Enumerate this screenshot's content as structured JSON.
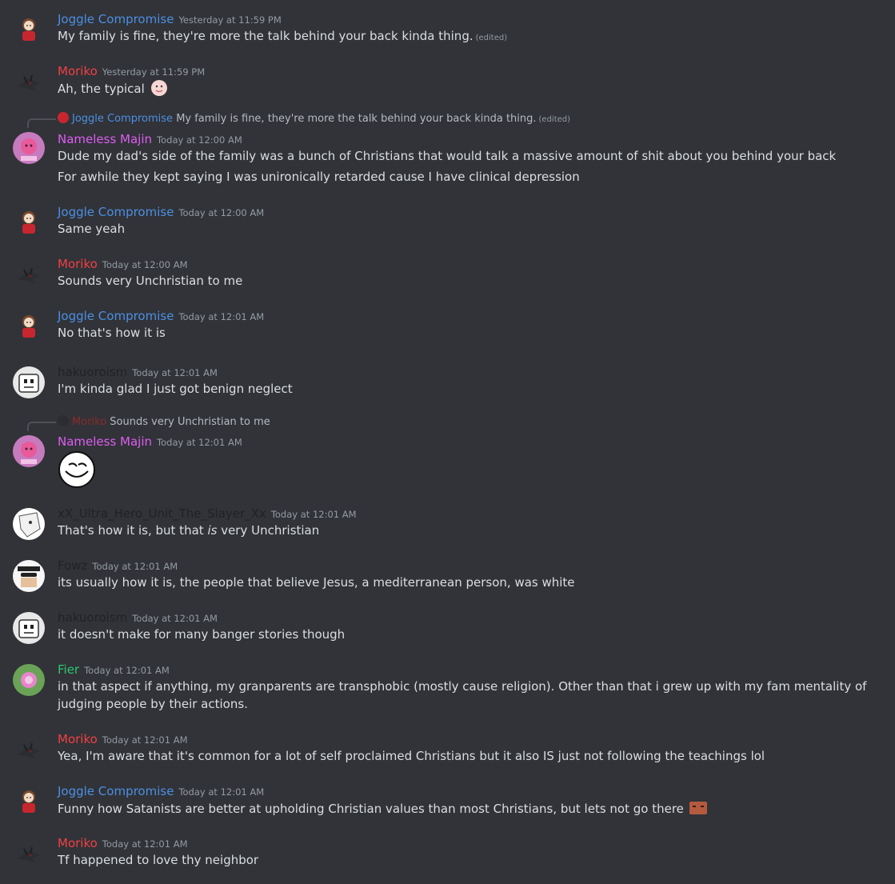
{
  "messages": [
    {
      "author": "Joggle Compromise",
      "time": "Yesterday at 11:59 PM",
      "lines": [
        "My family is fine, they're more the talk behind your back kinda thing."
      ],
      "edited": "(edited)"
    },
    {
      "author": "Moriko",
      "time": "Yesterday at 11:59 PM",
      "lines": [
        "Ah, the typical"
      ]
    },
    {
      "reply_author": "Joggle Compromise",
      "reply_text": "My family is fine, they're more the talk behind your back kinda thing.",
      "reply_edited": "(edited)",
      "author": "Nameless Majin",
      "time": "Today at 12:00 AM",
      "lines": [
        "Dude my dad's side of the family was a bunch of Christians that would talk a massive amount of shit about you behind your back",
        "For awhile they kept saying I was unironically retarded cause I have clinical depression"
      ]
    },
    {
      "author": "Joggle Compromise",
      "time": "Today at 12:00 AM",
      "lines": [
        "Same yeah"
      ]
    },
    {
      "author": "Moriko",
      "time": "Today at 12:00 AM",
      "lines": [
        "Sounds very Unchristian to me"
      ]
    },
    {
      "author": "Joggle Compromise",
      "time": "Today at 12:01 AM",
      "lines": [
        "No that's how it is"
      ]
    },
    {
      "author": "hakuoroism",
      "time": "Today at 12:01 AM",
      "lines": [
        "I'm kinda glad I just got benign neglect"
      ]
    },
    {
      "reply_author": "Moriko",
      "reply_text": "Sounds very Unchristian to me",
      "author": "Nameless Majin",
      "time": "Today at 12:01 AM",
      "lines": []
    },
    {
      "author": "xX_Ultra_Hero_Unit_The_Slayer_Xx",
      "time": "Today at 12:01 AM",
      "lines": [
        "That's how it is, but that"
      ],
      "italic": "is",
      "rest": "very Unchristian"
    },
    {
      "author": "Fowz",
      "time": "Today at 12:01 AM",
      "lines": [
        "its usually how it is, the people that believe Jesus, a mediterranean person, was white"
      ]
    },
    {
      "author": "hakuoroism",
      "time": "Today at 12:01 AM",
      "lines": [
        "it doesn't make for many banger stories though"
      ]
    },
    {
      "author": "Fier",
      "time": "Today at 12:01 AM",
      "lines": [
        "in that aspect if anything, my granparents are transphobic (mostly cause religion). Other than that i grew up with my fam mentality of judging people by their actions."
      ]
    },
    {
      "author": "Moriko",
      "time": "Today at 12:01 AM",
      "lines": [
        "Yea, I'm aware that it's common for a lot of self proclaimed Christians but it also IS just not following the teachings lol"
      ]
    },
    {
      "author": "Joggle Compromise",
      "time": "Today at 12:01 AM",
      "lines": [
        "Funny how Satanists are better at upholding Christian values than most Christians, but lets not go there"
      ]
    },
    {
      "author": "Moriko",
      "time": "Today at 12:01 AM",
      "lines": [
        "Tf happened to love thy  neighbor"
      ]
    }
  ],
  "colors": {
    "background": "#313338",
    "joggle": "#4c8fe2",
    "moriko": "#f23f43",
    "majin": "#e05cf3",
    "fier": "#2dc770",
    "dark": "#202225",
    "text": "#dbdee1",
    "muted": "#949ba4"
  }
}
